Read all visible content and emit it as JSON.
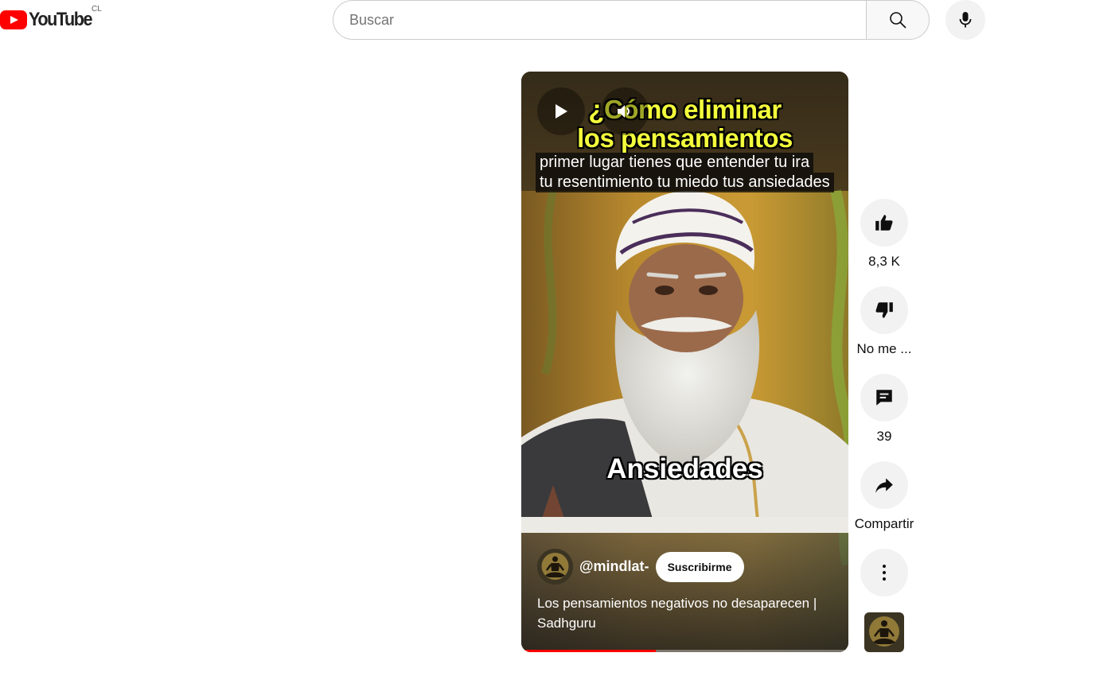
{
  "masthead": {
    "logo_text": "YouTube",
    "country_code": "CL",
    "search_placeholder": "Buscar",
    "search_value": ""
  },
  "short": {
    "title_overlay_line1": "¿Cómo eliminar",
    "title_overlay_line2": "los pensamientos",
    "caption_line1": "primer lugar tienes que entender tu ira",
    "caption_line2": "tu resentimiento tu miedo tus ansiedades",
    "word_overlay": "Ansiedades",
    "channel_handle": "@mindlat-",
    "subscribe_label": "Suscribirme",
    "video_title": "Los pensamientos negativos no desaparecen | Sadhguru",
    "progress_fraction": 0.41
  },
  "actions": {
    "like_count": "8,3 K",
    "dislike_label": "No me ...",
    "comment_count": "39",
    "share_label": "Compartir"
  },
  "colors": {
    "brand_red": "#ff0000",
    "overlay_yellow": "#f4ff3b",
    "button_bg": "#f2f2f2"
  }
}
